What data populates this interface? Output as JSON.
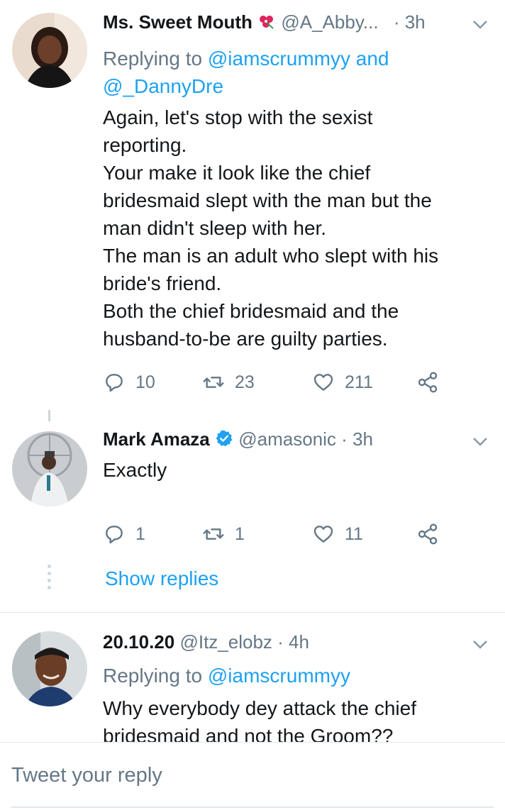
{
  "tweets": [
    {
      "name": "Ms. Sweet Mouth",
      "handle": "@A_Abby...",
      "time": "· 3h",
      "reply_prefix": "Replying to ",
      "reply_link": "@iamscrummyy and @_DannyDre",
      "text_lines": [
        "Again, let's stop with the sexist",
        "reporting.",
        "Your make it look like the chief",
        "bridesmaid slept with the man but the",
        "man didn't sleep with her.",
        "The man is an adult who slept with his",
        "bride's friend.",
        "Both the chief bridesmaid and the",
        "husband-to-be are guilty parties."
      ],
      "replies": "10",
      "retweets": "23",
      "likes": "211"
    },
    {
      "name": "Mark Amaza",
      "handle": "@amasonic",
      "time": "· 3h",
      "text": "Exactly",
      "replies": "1",
      "retweets": "1",
      "likes": "11"
    },
    {
      "name": "20.10.20",
      "handle": "@Itz_elobz",
      "time": "· 4h",
      "reply_prefix": "Replying to ",
      "reply_link": "@iamscrummyy",
      "text_lines": [
        "Why everybody dey attack the chief",
        "bridesmaid and not the Groom??"
      ]
    }
  ],
  "show_replies": "Show replies",
  "compose": {
    "placeholder": "Tweet your reply"
  },
  "icons": {
    "reply": "reply-icon",
    "retweet": "retweet-icon",
    "like": "heart-icon",
    "share": "share-icon",
    "caret": "chevron-down-icon",
    "verified": "verified-badge-icon",
    "emoji": "flower-emoji-icon"
  },
  "colors": {
    "link": "#1da1f2",
    "muted": "#657786",
    "text": "#14171a",
    "divider": "#e1e8ed"
  }
}
